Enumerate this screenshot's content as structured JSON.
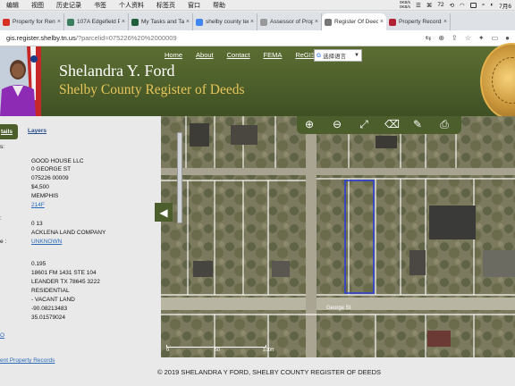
{
  "menubar": {
    "items": [
      "编辑",
      "视图",
      "历史记录",
      "书签",
      "个人资料",
      "标签页",
      "窗口",
      "帮助"
    ],
    "kbps_up": "0KB/s",
    "kbps_down": "0KB/s",
    "badge": "72",
    "clock": "7月6"
  },
  "tabs": [
    {
      "title": "Property for Rent in",
      "color": "#d93025"
    },
    {
      "title": "107A Edgefield Pla",
      "color": "#3b7f5f"
    },
    {
      "title": "My Tasks and Task",
      "color": "#1f5e3a"
    },
    {
      "title": "shelby county tenn",
      "color": "#4285f4"
    },
    {
      "title": "Assessor of Prope",
      "color": "#9a9a9a"
    },
    {
      "title": "Register Of Deeds",
      "color": "#777777"
    },
    {
      "title": "Property Records",
      "color": "#b22234"
    }
  ],
  "address": {
    "host": "gis.register.shelby.tn.us",
    "path": "/?parcelid=075226%20%2000009"
  },
  "header": {
    "title": "Shelandra Y. Ford",
    "subtitle": "Shelby County Register of Deeds",
    "nav": [
      "Home",
      "About",
      "Contact",
      "FEMA",
      "ReGIS"
    ],
    "translate": "选择语言"
  },
  "panel": {
    "tab_details": "tails",
    "tab_layers": "Layers",
    "row1_label": "s:",
    "owner": "GOOD HOUSE LLC",
    "address": "0 GEORGE ST",
    "parcel": "075226 00009",
    "value": "$4,500",
    "city": "MEMPHIS",
    "map_link": "214F",
    "sub_label": ":",
    "lot": "0 13",
    "subdivision": "ACKLENA LAND COMPANY",
    "unknown_label": "e :",
    "unknown": "UNKNOWN",
    "acres": "0.195",
    "mail1": "18601 FM 1431 STE 104",
    "mail2": "LEANDER TX 78645 3222",
    "use": "RESIDENTIAL",
    "use2": "- VACANT LAND",
    "lon": "-90.08213483",
    "lat": "35.01579024",
    "tiny_link": "O",
    "records_link": "ent Property Records"
  },
  "map": {
    "street": "George St",
    "scale": [
      "0",
      "50",
      "100ft"
    ]
  },
  "footer": "© 2019 SHELANDRA Y FORD, SHELBY COUNTY REGISTER OF DEEDS"
}
